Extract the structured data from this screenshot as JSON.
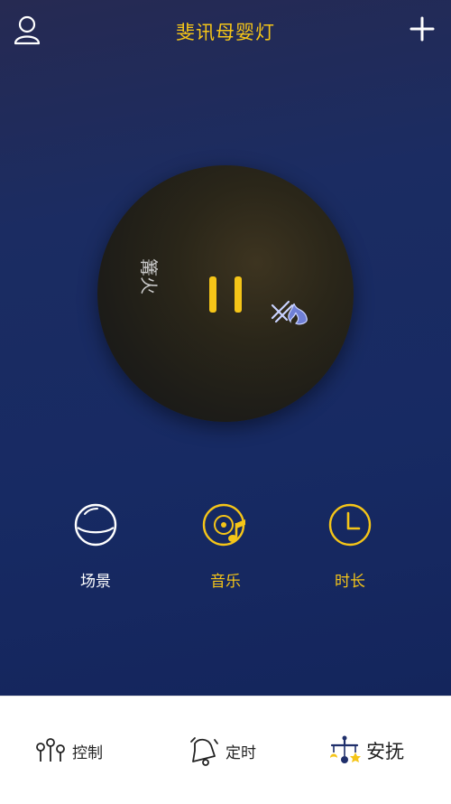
{
  "header": {
    "title": "斐讯母婴灯",
    "user_icon": "user-icon",
    "add_icon": "plus-icon"
  },
  "player": {
    "state": "playing",
    "control_icon": "pause-icon",
    "left_glyph": "篝火",
    "right_glyph_icon": "campfire-icon"
  },
  "features": [
    {
      "label": "场景",
      "icon": "globe-icon",
      "color": "#ffffff"
    },
    {
      "label": "音乐",
      "icon": "music-disc-icon",
      "color": "#f5c518"
    },
    {
      "label": "时长",
      "icon": "clock-icon",
      "color": "#f5c518"
    }
  ],
  "tabs": [
    {
      "label": "控制",
      "icon": "sliders-icon",
      "active": false
    },
    {
      "label": "定时",
      "icon": "alarm-bell-icon",
      "active": false
    },
    {
      "label": "安抚",
      "icon": "baby-mobile-icon",
      "active": true
    }
  ],
  "colors": {
    "accent": "#f5c518",
    "background_top": "#262a52",
    "background_bottom": "#14255c",
    "tabbar": "#ffffff"
  }
}
